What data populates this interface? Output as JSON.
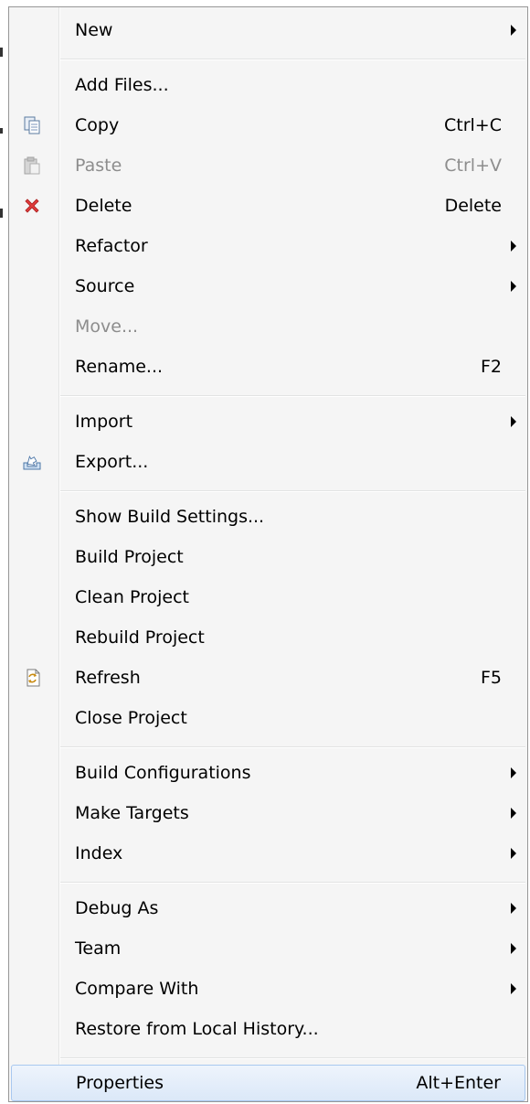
{
  "menu": {
    "items": [
      {
        "label": "New",
        "submenu": true
      },
      {
        "label": "Add Files..."
      },
      {
        "label": "Copy",
        "shortcut": "Ctrl+C",
        "icon": "copy-icon"
      },
      {
        "label": "Paste",
        "shortcut": "Ctrl+V",
        "icon": "paste-icon",
        "disabled": true
      },
      {
        "label": "Delete",
        "shortcut": "Delete",
        "icon": "delete-icon"
      },
      {
        "label": "Refactor",
        "submenu": true
      },
      {
        "label": "Source",
        "submenu": true
      },
      {
        "label": "Move...",
        "disabled": true
      },
      {
        "label": "Rename...",
        "shortcut": "F2"
      },
      {
        "label": "Import",
        "submenu": true
      },
      {
        "label": "Export...",
        "icon": "export-icon"
      },
      {
        "label": "Show Build Settings..."
      },
      {
        "label": "Build Project"
      },
      {
        "label": "Clean Project"
      },
      {
        "label": "Rebuild Project"
      },
      {
        "label": "Refresh",
        "shortcut": "F5",
        "icon": "refresh-icon"
      },
      {
        "label": "Close Project"
      },
      {
        "label": "Build Configurations",
        "submenu": true
      },
      {
        "label": "Make Targets",
        "submenu": true
      },
      {
        "label": "Index",
        "submenu": true
      },
      {
        "label": "Debug As",
        "submenu": true
      },
      {
        "label": "Team",
        "submenu": true
      },
      {
        "label": "Compare With",
        "submenu": true
      },
      {
        "label": "Restore from Local History..."
      },
      {
        "label": "Properties",
        "shortcut": "Alt+Enter",
        "highlighted": true
      }
    ]
  }
}
